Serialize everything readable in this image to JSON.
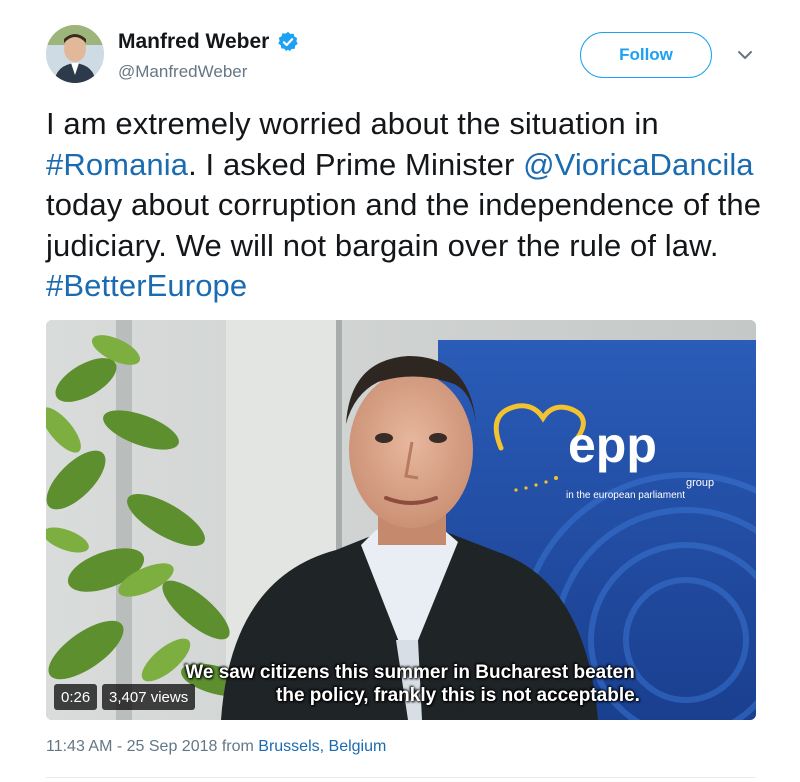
{
  "author": {
    "name": "Manfred Weber",
    "handle": "@ManfredWeber",
    "verified": true,
    "avatar_icon": "avatar-photo"
  },
  "actions": {
    "follow_label": "Follow",
    "more_icon": "chevron-down-icon"
  },
  "tweet": {
    "segments": [
      {
        "text": "I am extremely worried about the situation in ",
        "type": "text"
      },
      {
        "text": "#Romania",
        "type": "link"
      },
      {
        "text": ". I asked Prime Minister ",
        "type": "text"
      },
      {
        "text": "@VioricaDancila",
        "type": "link"
      },
      {
        "text": " today about corruption and the independence of the judiciary. We will not bargain over the rule of law. ",
        "type": "text"
      },
      {
        "text": "#BetterEurope",
        "type": "link"
      }
    ]
  },
  "video": {
    "caption_line1": "We saw citizens this summer in Bucharest beaten",
    "caption_line2": "the policy, frankly this is not acceptable.",
    "duration": "0:26",
    "views": "3,407 views",
    "banner_logo": "epp",
    "banner_sub1": "group",
    "banner_sub2": "in the european parliament"
  },
  "meta": {
    "time": "11:43 AM - 25 Sep 2018 from ",
    "place": "Brussels, Belgium"
  },
  "colors": {
    "link": "#1b6bb0",
    "follow": "#1da1f2",
    "muted": "#657786",
    "banner": "#1f4fa6"
  }
}
